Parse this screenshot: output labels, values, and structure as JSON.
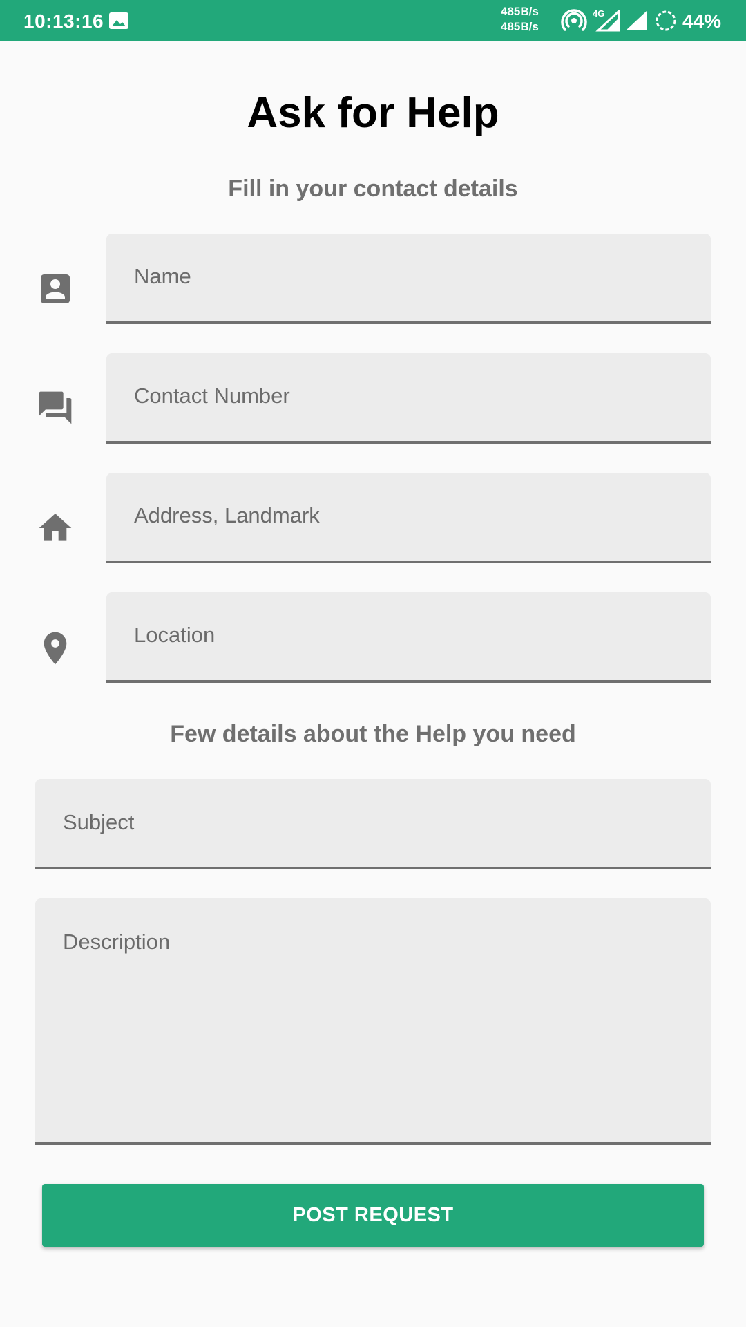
{
  "status_bar": {
    "time": "10:13:16",
    "speed_up": "485B/s",
    "speed_down": "485B/s",
    "network_label": "4G",
    "battery": "44%",
    "background_color": "#22a87a"
  },
  "header": {
    "title": "Ask for Help",
    "contact_subtitle": "Fill in your contact details",
    "help_subtitle": "Few details about the Help you need"
  },
  "contact_fields": {
    "name": {
      "placeholder": "Name",
      "icon": "account-box-icon"
    },
    "contact_number": {
      "placeholder": "Contact Number",
      "icon": "forum-icon"
    },
    "address": {
      "placeholder": "Address, Landmark",
      "icon": "home-icon"
    },
    "location": {
      "placeholder": "Location",
      "icon": "place-icon"
    }
  },
  "help_fields": {
    "subject": {
      "placeholder": "Subject"
    },
    "description": {
      "placeholder": "Description"
    }
  },
  "actions": {
    "post_label": "POST REQUEST",
    "accent_color": "#22a87a"
  }
}
